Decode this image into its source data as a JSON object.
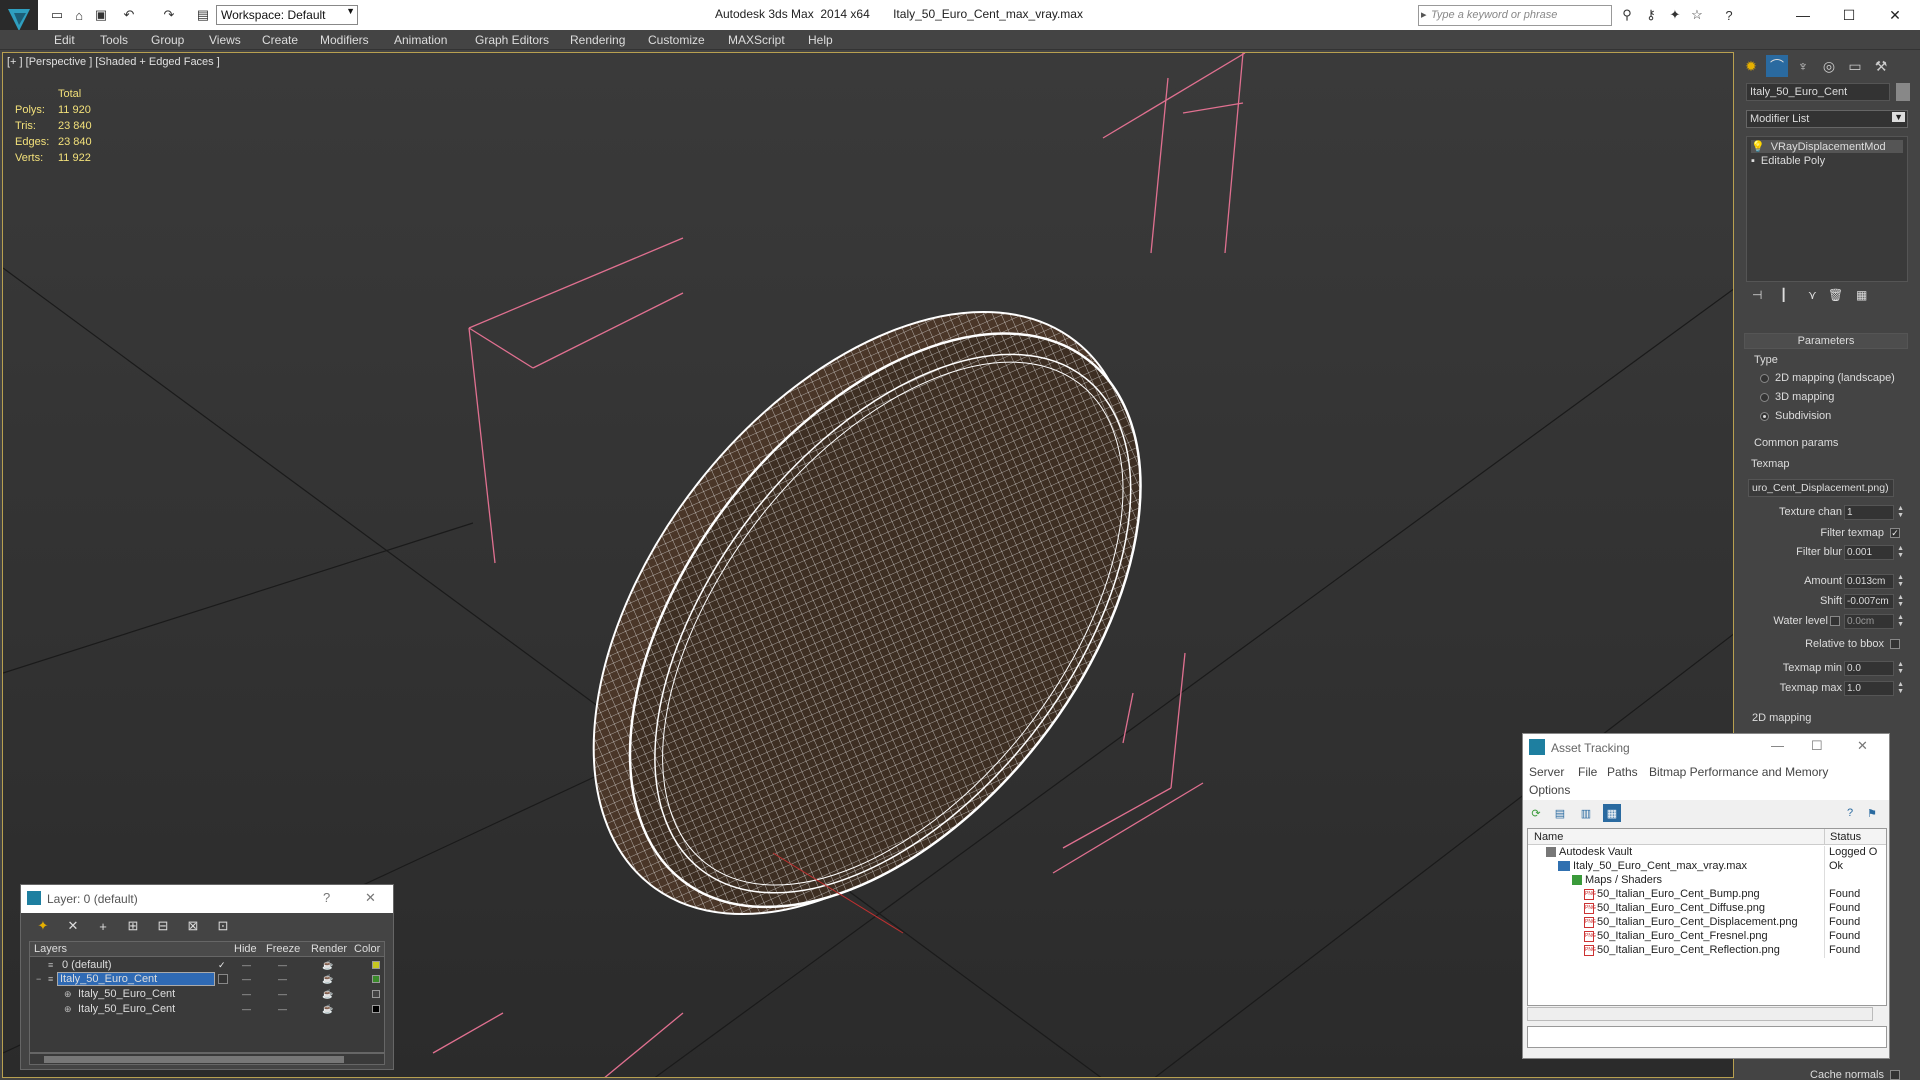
{
  "titlebar": {
    "workspace_label": "Workspace: Default",
    "title": "Autodesk 3ds Max  2014 x64       Italy_50_Euro_Cent_max_vray.max",
    "search_placeholder": "Type a keyword or phrase"
  },
  "menu": [
    "Edit",
    "Tools",
    "Group",
    "Views",
    "Create",
    "Modifiers",
    "Animation",
    "Graph Editors",
    "Rendering",
    "Customize",
    "MAXScript",
    "Help"
  ],
  "viewport": {
    "label": "[+ ] [Perspective ] [Shaded + Edged Faces ]",
    "stats_header": "Total",
    "stats": [
      {
        "k": "Polys:",
        "v": "11 920"
      },
      {
        "k": "Tris:",
        "v": "23 840"
      },
      {
        "k": "Edges:",
        "v": "23 840"
      },
      {
        "k": "Verts:",
        "v": "11 922"
      }
    ]
  },
  "command_panel": {
    "object_name": "Italy_50_Euro_Cent",
    "modifier_list": "Modifier List",
    "stack": [
      "VRayDisplacementMod",
      "Editable Poly"
    ],
    "parameters_title": "Parameters",
    "type_label": "Type",
    "type_options": [
      {
        "label": "2D mapping (landscape)",
        "selected": false
      },
      {
        "label": "3D mapping",
        "selected": false
      },
      {
        "label": "Subdivision",
        "selected": true
      }
    ],
    "common_params": "Common params",
    "texmap_label": "Texmap",
    "texmap_value": "uro_Cent_Displacement.png)",
    "texture_chan_label": "Texture chan",
    "texture_chan": "1",
    "filter_texmap_label": "Filter texmap",
    "filter_blur_label": "Filter blur",
    "filter_blur": "0.001",
    "amount_label": "Amount",
    "amount": "0.013cm",
    "shift_label": "Shift",
    "shift": "-0.007cm",
    "water_level_label": "Water level",
    "water_level": "0.0cm",
    "relative_bbox_label": "Relative to bbox",
    "texmap_min_label": "Texmap min",
    "texmap_min": "0.0",
    "texmap_max_label": "Texmap max",
    "texmap_max": "1.0",
    "mapping_2d": "2D mapping",
    "cache_normals": "Cache normals"
  },
  "asset_tracking": {
    "title": "Asset Tracking",
    "menu": [
      "Server",
      "File",
      "Paths",
      "Bitmap Performance and Memory",
      "Options"
    ],
    "columns": [
      "Name",
      "Status"
    ],
    "rows": [
      {
        "name": "Autodesk Vault",
        "status": "Logged O",
        "icon": "vault"
      },
      {
        "name": "Italy_50_Euro_Cent_max_vray.max",
        "status": "Ok",
        "icon": "max"
      },
      {
        "name": "Maps / Shaders",
        "status": "",
        "icon": "maps"
      },
      {
        "name": "50_Italian_Euro_Cent_Bump.png",
        "status": "Found",
        "icon": "png"
      },
      {
        "name": "50_Italian_Euro_Cent_Diffuse.png",
        "status": "Found",
        "icon": "png"
      },
      {
        "name": "50_Italian_Euro_Cent_Displacement.png",
        "status": "Found",
        "icon": "png"
      },
      {
        "name": "50_Italian_Euro_Cent_Fresnel.png",
        "status": "Found",
        "icon": "png"
      },
      {
        "name": "50_Italian_Euro_Cent_Reflection.png",
        "status": "Found",
        "icon": "png"
      }
    ]
  },
  "layer_window": {
    "title": "Layer: 0 (default)",
    "help": "?",
    "columns": [
      "Layers",
      "Hide",
      "Freeze",
      "Render",
      "Color"
    ],
    "rows": [
      {
        "name": "0 (default)",
        "color": "#c8c820"
      },
      {
        "name": "Italy_50_Euro_Cent",
        "color": "#3a8a2a"
      },
      {
        "name": "Italy_50_Euro_Cent",
        "color": "#444444"
      },
      {
        "name": "Italy_50_Euro_Cent",
        "color": "#000000"
      }
    ]
  },
  "colors": {
    "accent": "#e6b000",
    "selection": "#2f6ab4",
    "bbox": "#e07090",
    "wire": "#f0f0f0"
  }
}
